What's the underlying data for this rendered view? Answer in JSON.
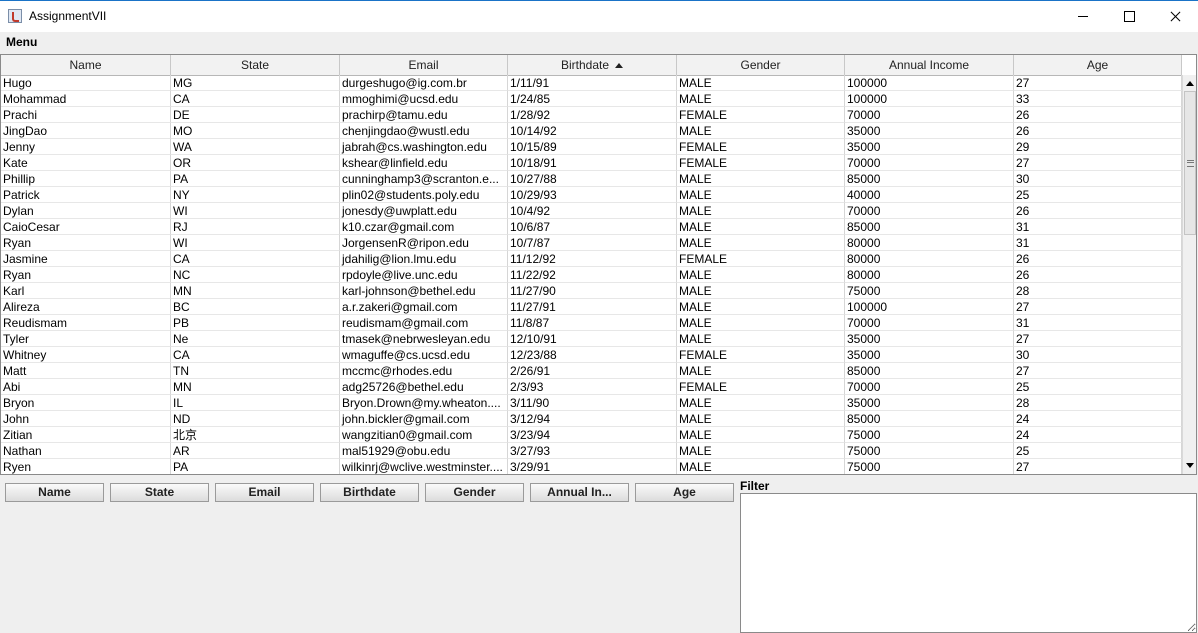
{
  "window": {
    "title": "AssignmentVII"
  },
  "menubar": {
    "menu_label": "Menu"
  },
  "table": {
    "columns": [
      "Name",
      "State",
      "Email",
      "Birthdate",
      "Gender",
      "Annual Income",
      "Age"
    ],
    "sorted_column": "Birthdate",
    "sort_direction": "ascending",
    "rows": [
      [
        "Hugo",
        "MG",
        "durgeshugo@ig.com.br",
        "1/11/91",
        "MALE",
        "100000",
        "27"
      ],
      [
        "Mohammad",
        "CA",
        "mmoghimi@ucsd.edu",
        "1/24/85",
        "MALE",
        "100000",
        "33"
      ],
      [
        "Prachi",
        "DE",
        "prachirp@tamu.edu",
        "1/28/92",
        "FEMALE",
        "70000",
        "26"
      ],
      [
        "JingDao",
        "MO",
        "chenjingdao@wustl.edu",
        "10/14/92",
        "MALE",
        "35000",
        "26"
      ],
      [
        "Jenny",
        "WA",
        "jabrah@cs.washington.edu",
        "10/15/89",
        "FEMALE",
        "35000",
        "29"
      ],
      [
        "Kate",
        "OR",
        "kshear@linfield.edu",
        "10/18/91",
        "FEMALE",
        "70000",
        "27"
      ],
      [
        "Phillip",
        "PA",
        "cunninghamp3@scranton.e...",
        "10/27/88",
        "MALE",
        "85000",
        "30"
      ],
      [
        "Patrick",
        "NY",
        "plin02@students.poly.edu",
        "10/29/93",
        "MALE",
        "40000",
        "25"
      ],
      [
        "Dylan",
        "WI",
        "jonesdy@uwplatt.edu",
        "10/4/92",
        "MALE",
        "70000",
        "26"
      ],
      [
        "CaioCesar",
        "RJ",
        "k10.czar@gmail.com",
        "10/6/87",
        "MALE",
        "85000",
        "31"
      ],
      [
        "Ryan",
        "WI",
        "JorgensenR@ripon.edu",
        "10/7/87",
        "MALE",
        "80000",
        "31"
      ],
      [
        "Jasmine",
        "CA",
        "jdahilig@lion.lmu.edu",
        "11/12/92",
        "FEMALE",
        "80000",
        "26"
      ],
      [
        "Ryan",
        "NC",
        "rpdoyle@live.unc.edu",
        "11/22/92",
        "MALE",
        "80000",
        "26"
      ],
      [
        "Karl",
        "MN",
        "karl-johnson@bethel.edu",
        "11/27/90",
        "MALE",
        "75000",
        "28"
      ],
      [
        "Alireza",
        "BC",
        "a.r.zakeri@gmail.com",
        "11/27/91",
        "MALE",
        "100000",
        "27"
      ],
      [
        "Reudismam",
        "PB",
        "reudismam@gmail.com",
        "11/8/87",
        "MALE",
        "70000",
        "31"
      ],
      [
        "Tyler",
        "Ne",
        "tmasek@nebrwesleyan.edu",
        "12/10/91",
        "MALE",
        "35000",
        "27"
      ],
      [
        "Whitney",
        "CA",
        "wmaguffe@cs.ucsd.edu",
        "12/23/88",
        "FEMALE",
        "35000",
        "30"
      ],
      [
        "Matt",
        "TN",
        "mccmc@rhodes.edu",
        "2/26/91",
        "MALE",
        "85000",
        "27"
      ],
      [
        "Abi",
        "MN",
        "adg25726@bethel.edu",
        "2/3/93",
        "FEMALE",
        "70000",
        "25"
      ],
      [
        "Bryon",
        "IL",
        "Bryon.Drown@my.wheaton....",
        "3/11/90",
        "MALE",
        "35000",
        "28"
      ],
      [
        "John",
        "ND",
        "john.bickler@gmail.com",
        "3/12/94",
        "MALE",
        "85000",
        "24"
      ],
      [
        "Zitian",
        "北京",
        "wangzitian0@gmail.com",
        "3/23/94",
        "MALE",
        "75000",
        "24"
      ],
      [
        "Nathan",
        "AR",
        "mal51929@obu.edu",
        "3/27/93",
        "MALE",
        "75000",
        "25"
      ],
      [
        "Ryen",
        "PA",
        "wilkinrj@wclive.westminster....",
        "3/29/91",
        "MALE",
        "75000",
        "27"
      ]
    ]
  },
  "buttons": [
    "Name",
    "State",
    "Email",
    "Birthdate",
    "Gender",
    "Annual In...",
    "Age"
  ],
  "filter": {
    "label": "Filter",
    "value": ""
  }
}
